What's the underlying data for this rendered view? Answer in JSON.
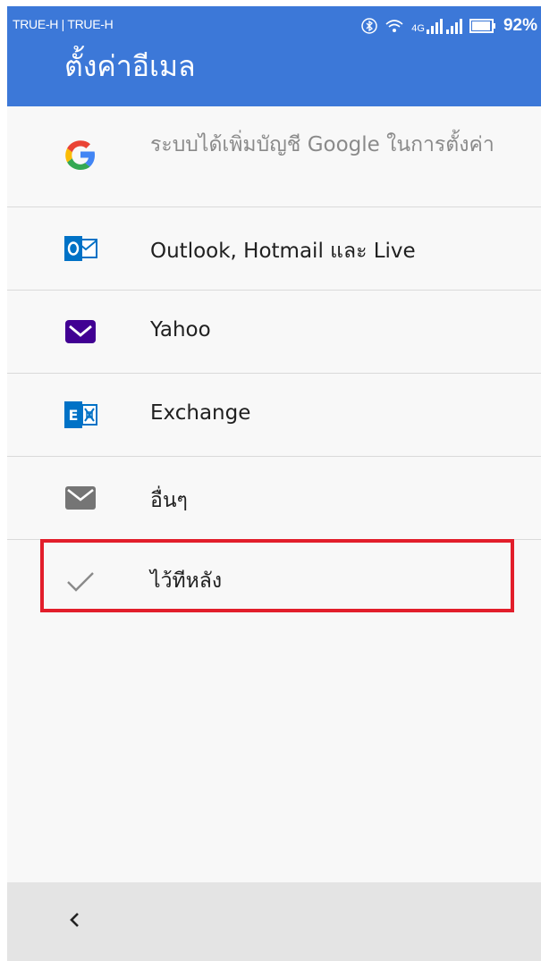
{
  "status_bar": {
    "carriers": "TRUE-H | TRUE-H",
    "network": "4G",
    "battery": "92%"
  },
  "header": {
    "title": "ตั้งค่าอีเมล"
  },
  "options": [
    {
      "label": "ระบบได้เพิ่มบัญชี Google ในการตั้งค่า",
      "icon": "google-icon"
    },
    {
      "label": "Outlook, Hotmail และ Live",
      "icon": "outlook-icon"
    },
    {
      "label": "Yahoo",
      "icon": "yahoo-mail-icon"
    },
    {
      "label": "Exchange",
      "icon": "exchange-icon"
    },
    {
      "label": "อื่นๆ",
      "icon": "envelope-icon"
    },
    {
      "label": "ไว้ทีหลัง",
      "icon": "checkmark-icon"
    }
  ],
  "colors": {
    "appbar": "#3c78d8",
    "highlight": "#e21e2b",
    "navbar": "#e4e4e4"
  },
  "navigation": {
    "back_icon": "chevron-left-icon"
  }
}
